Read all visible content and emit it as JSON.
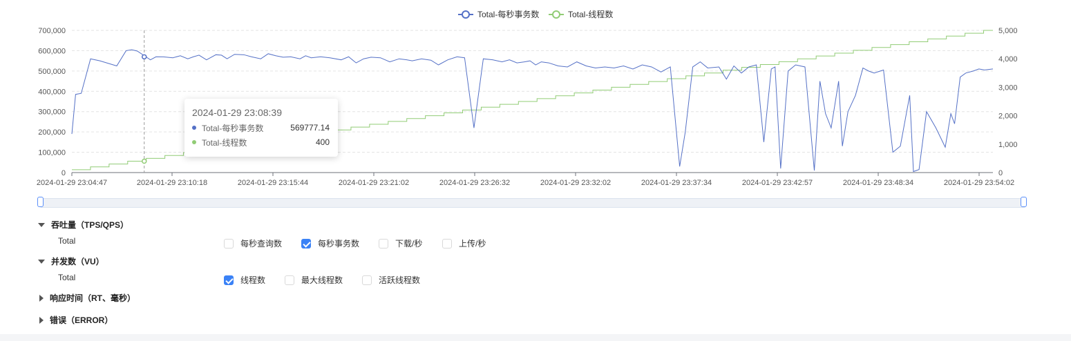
{
  "chart_data": {
    "type": "line",
    "legend": {
      "position": "top",
      "entries": [
        "Total-每秒事务数",
        "Total-线程数"
      ]
    },
    "x_ticks": [
      "2024-01-29 23:04:47",
      "2024-01-29 23:10:18",
      "2024-01-29 23:15:44",
      "2024-01-29 23:21:02",
      "2024-01-29 23:26:32",
      "2024-01-29 23:32:02",
      "2024-01-29 23:37:34",
      "2024-01-29 23:42:57",
      "2024-01-29 23:48:34",
      "2024-01-29 23:54:02"
    ],
    "y_left": {
      "min": 0,
      "max": 700000,
      "ticks": [
        "0",
        "100,000",
        "200,000",
        "300,000",
        "400,000",
        "500,000",
        "600,000",
        "700,000"
      ]
    },
    "y_right": {
      "min": 0,
      "max": 5000,
      "ticks": [
        "0",
        "1,000",
        "2,000",
        "3,000",
        "4,000",
        "5,000"
      ]
    },
    "grid": true,
    "x_range_minutes": [
      0,
      49.25
    ],
    "series": [
      {
        "name": "Total-每秒事务数",
        "color": "#5470c6",
        "axis": "left",
        "x": [
          0,
          0.2,
          0.5,
          1,
          1.5,
          2.4,
          2.9,
          3.2,
          3.5,
          4.2,
          4.5,
          4.9,
          5.4,
          5.8,
          6.2,
          6.5,
          6.8,
          7.2,
          7.7,
          8,
          8.3,
          8.7,
          9.2,
          9.6,
          10.1,
          10.5,
          10.9,
          11.3,
          11.7,
          12.2,
          12.5,
          12.8,
          13.3,
          13.8,
          14.4,
          14.8,
          15.2,
          15.6,
          16,
          16.5,
          17,
          17.5,
          17.9,
          18.2,
          18.7,
          19.2,
          19.6,
          20.1,
          20.6,
          21,
          21.5,
          22,
          22.5,
          23,
          23.4,
          23.8,
          24.2,
          24.5,
          24.8,
          25.1,
          25.5,
          26,
          26.5,
          27,
          27.5,
          28,
          28.5,
          29,
          29.5,
          30,
          30.5,
          31,
          31.5,
          32,
          32.5,
          32.8,
          33.2,
          33.6,
          34,
          34.6,
          35,
          35.4,
          35.8,
          36.2,
          36.6,
          37,
          37.4,
          37.6,
          37.9,
          38.3,
          38.7,
          39.2,
          39.7,
          40,
          40.3,
          40.6,
          41,
          41.2,
          41.5,
          41.9,
          42.3,
          42.6,
          42.9,
          43.4,
          43.9,
          44.3,
          44.8,
          45,
          45.3,
          45.7,
          46.2,
          46.7,
          47,
          47.2,
          47.5,
          47.8,
          48.2,
          48.5,
          48.8,
          49.25
        ],
        "y": [
          190000,
          385000,
          390000,
          560000,
          550000,
          525000,
          600000,
          605000,
          598000,
          555000,
          570000,
          569777,
          565000,
          575000,
          560000,
          570000,
          578000,
          555000,
          580000,
          578000,
          560000,
          582000,
          580000,
          570000,
          560000,
          585000,
          575000,
          568000,
          570000,
          560000,
          575000,
          565000,
          570000,
          565000,
          555000,
          570000,
          540000,
          560000,
          568000,
          565000,
          545000,
          560000,
          555000,
          550000,
          560000,
          553000,
          530000,
          555000,
          570000,
          565000,
          220000,
          560000,
          555000,
          545000,
          555000,
          540000,
          545000,
          550000,
          530000,
          545000,
          540000,
          525000,
          520000,
          545000,
          525000,
          515000,
          520000,
          515000,
          525000,
          510000,
          530000,
          520000,
          495000,
          520000,
          30000,
          200000,
          520000,
          545000,
          515000,
          520000,
          460000,
          525000,
          490000,
          520000,
          530000,
          150000,
          510000,
          520000,
          20000,
          500000,
          530000,
          520000,
          10000,
          450000,
          290000,
          220000,
          450000,
          130000,
          300000,
          380000,
          515000,
          500000,
          490000,
          505000,
          100000,
          130000,
          380000,
          5000,
          15000,
          300000,
          220000,
          125000,
          290000,
          240000,
          470000,
          490000,
          500000,
          510000,
          505000,
          510000
        ]
      },
      {
        "name": "Total-线程数",
        "color": "#91cc75",
        "axis": "right",
        "steps": "each minute of the run the thread count rises by 100, from 100 at start to 5000 at the end",
        "start": 100,
        "step_size": 100,
        "end": 5000
      }
    ],
    "crosshair_x_label": "2024-01-29 23:08:39",
    "crosshair_x": 3.87
  },
  "tooltip": {
    "title": "2024-01-29 23:08:39",
    "rows": [
      {
        "name": "Total-每秒事务数",
        "value": "569777.14",
        "color": "#5470c6"
      },
      {
        "name": "Total-线程数",
        "value": "400",
        "color": "#91cc75"
      }
    ]
  },
  "sections": {
    "throughput": {
      "title": "吞吐量（TPS/QPS）",
      "row_label": "Total",
      "options": [
        {
          "label": "每秒查询数",
          "checked": false
        },
        {
          "label": "每秒事务数",
          "checked": true
        },
        {
          "label": "下载/秒",
          "checked": false
        },
        {
          "label": "上传/秒",
          "checked": false
        }
      ]
    },
    "concurrency": {
      "title": "并发数（VU）",
      "row_label": "Total",
      "options": [
        {
          "label": "线程数",
          "checked": true
        },
        {
          "label": "最大线程数",
          "checked": false
        },
        {
          "label": "活跃线程数",
          "checked": false
        }
      ]
    },
    "response_time": {
      "title": "响应时间（RT、毫秒）"
    },
    "errors": {
      "title": "错误（ERROR）"
    }
  }
}
